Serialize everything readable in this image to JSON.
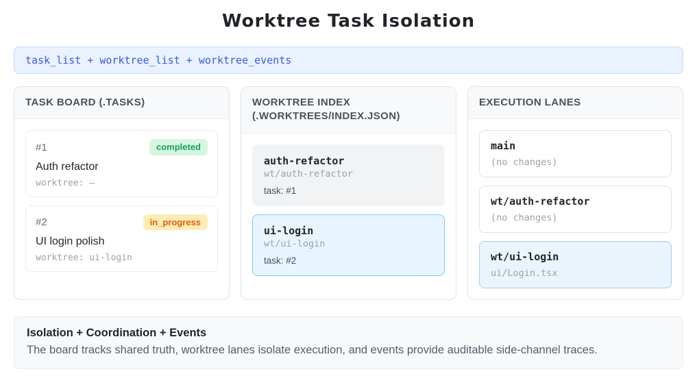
{
  "title": "Worktree Task Isolation",
  "banner": {
    "text": "task_list + worktree_list + worktree_events"
  },
  "panels": {
    "task_board": {
      "header": "TASK BOARD (.TASKS)",
      "tasks": [
        {
          "id": "#1",
          "status": "completed",
          "title": "Auth refactor",
          "worktree": "worktree: –"
        },
        {
          "id": "#2",
          "status": "in_progress",
          "title": "UI login polish",
          "worktree": "worktree: ui-login"
        }
      ]
    },
    "worktree_index": {
      "header": "WORKTREE INDEX (.WORKTREES/INDEX.JSON)",
      "worktrees": [
        {
          "name": "auth-refactor",
          "path": "wt/auth-refactor",
          "task": "task: #1"
        },
        {
          "name": "ui-login",
          "path": "wt/ui-login",
          "task": "task: #2"
        }
      ]
    },
    "execution_lanes": {
      "header": "EXECUTION LANES",
      "lanes": [
        {
          "name": "main",
          "detail": "(no changes)"
        },
        {
          "name": "wt/auth-refactor",
          "detail": "(no changes)"
        },
        {
          "name": "wt/ui-login",
          "detail": "ui/Login.tsx"
        }
      ]
    }
  },
  "footer": {
    "heading": "Isolation + Coordination + Events",
    "body": "The board tracks shared truth, worktree lanes isolate execution, and events provide auditable side-channel traces."
  },
  "colors": {
    "banner_bg": "#e9f2fe",
    "banner_text": "#3b5bdb",
    "completed_badge_bg": "#d7f6e0",
    "completed_badge_text": "#18a05e",
    "in_progress_badge_bg": "#fdedb5",
    "in_progress_badge_text": "#e25c0d",
    "highlight_card_bg": "#e9f5fe",
    "highlight_card_border": "#7cc7f8",
    "panel_border": "#dee2e6",
    "panel_header_bg": "#f8f9fa"
  }
}
